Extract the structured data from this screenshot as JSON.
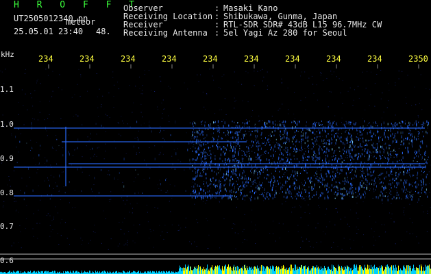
{
  "header": {
    "title": "H R O F F T",
    "filename": "UT2505012340.pn",
    "meteor_label": "meteor",
    "datetime": "25.05.01 23:40",
    "count": "48.",
    "rows": [
      {
        "label": "Observer",
        "value": "Masaki Kano"
      },
      {
        "label": "Receiving Location",
        "value": "Shibukawa, Gunma, Japan"
      },
      {
        "label": "Receiver",
        "value": "RTL-SDR SDR# 43dB L15 96.7MHz CW"
      },
      {
        "label": "Receiving Antenna",
        "value": "5el Yagi Az 280 for Seoul"
      }
    ],
    "colon": ":"
  },
  "axes": {
    "y_unit": "kHz",
    "x_ticks": [
      "234",
      "234",
      "234",
      "234",
      "234",
      "234",
      "234",
      "234",
      "234",
      "2350"
    ],
    "y_ticks": [
      "1.1",
      "1.0",
      "0.9",
      "0.8",
      "0.7",
      "0.6"
    ]
  },
  "colors": {
    "background": "#000000",
    "signal": "#2a6bff",
    "signal_bright": "#7fd4ff",
    "tick_text": "#ffff40",
    "title_text": "#3cff3c",
    "power_trace": "#00d0ff",
    "power_peaks": "#ffff00"
  }
}
